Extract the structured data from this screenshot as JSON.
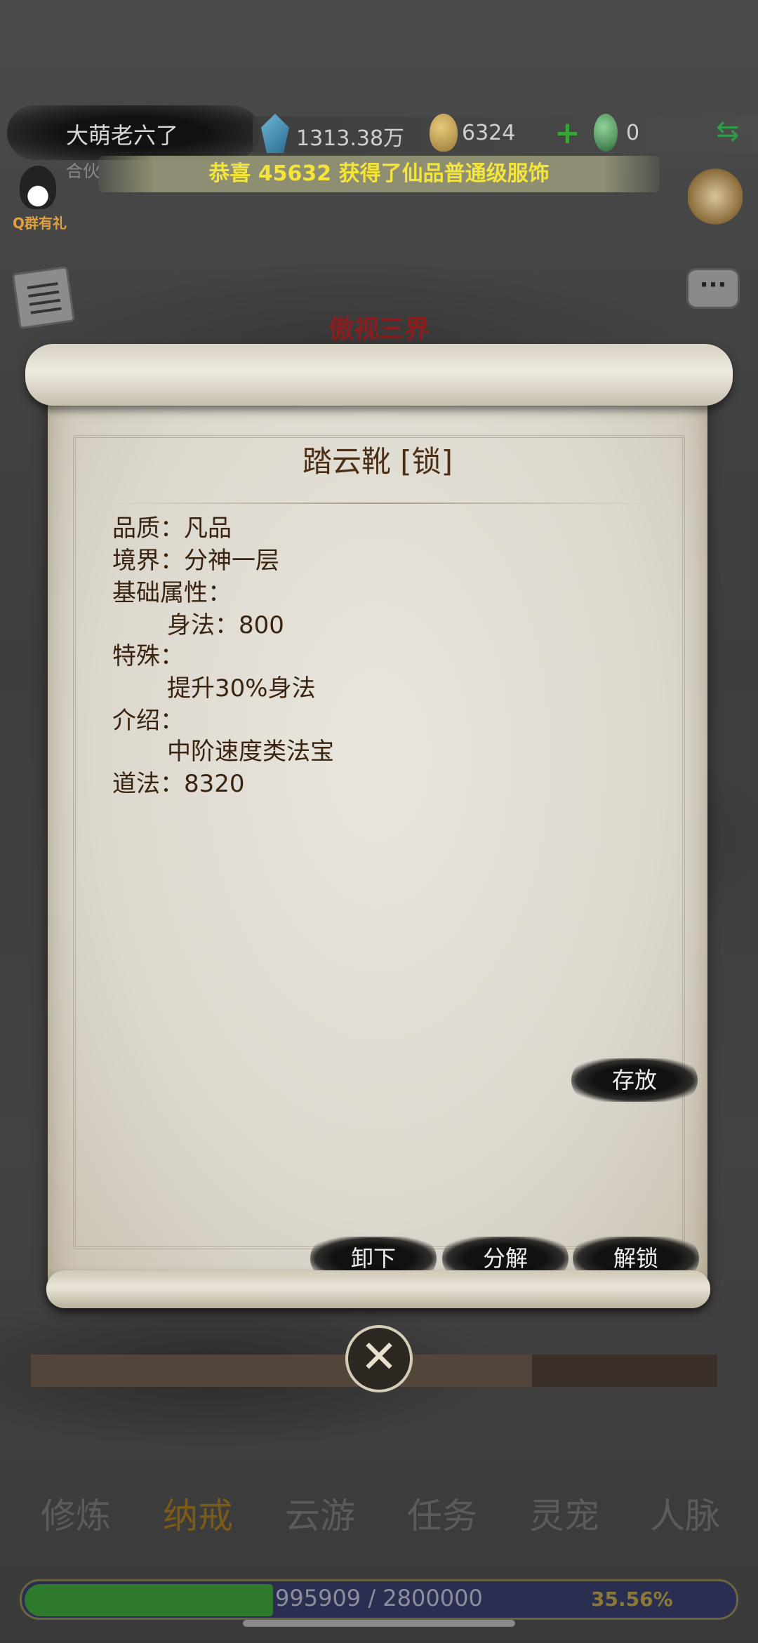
{
  "header": {
    "player_name": "大萌老六了",
    "sub_name": "合伙",
    "spirit_stones": "1313.38万",
    "coins": "6324",
    "jade": "0",
    "announcement": "恭喜 45632 获得了仙品普通级服饰",
    "qq_label": "Q群有礼",
    "region_title": "傲视三界"
  },
  "item": {
    "title": "踏云靴 [锁]",
    "lines": [
      "品质：凡品",
      "境界：分神一层",
      "基础属性：",
      "身法：800",
      "特殊：",
      "提升30%身法",
      "介绍：",
      "中阶速度类法宝",
      "道法：8320"
    ]
  },
  "buttons": {
    "store": "存放",
    "unequip": "卸下",
    "decompose": "分解",
    "unlock": "解锁",
    "close": "✕"
  },
  "progress": {
    "fill_fraction": 0.73
  },
  "nav": {
    "tabs": [
      "修炼",
      "纳戒",
      "云游",
      "任务",
      "灵宠",
      "人脉"
    ],
    "active_index": 1
  },
  "exp": {
    "text": "995909 / 2800000",
    "percent": "35.56%",
    "fraction": 0.3556
  },
  "icons": {
    "gem": "spirit-stone-icon",
    "coin": "coin-bag-icon",
    "plus": "plus-icon",
    "jade": "jade-icon",
    "swap": "swap-icon"
  }
}
